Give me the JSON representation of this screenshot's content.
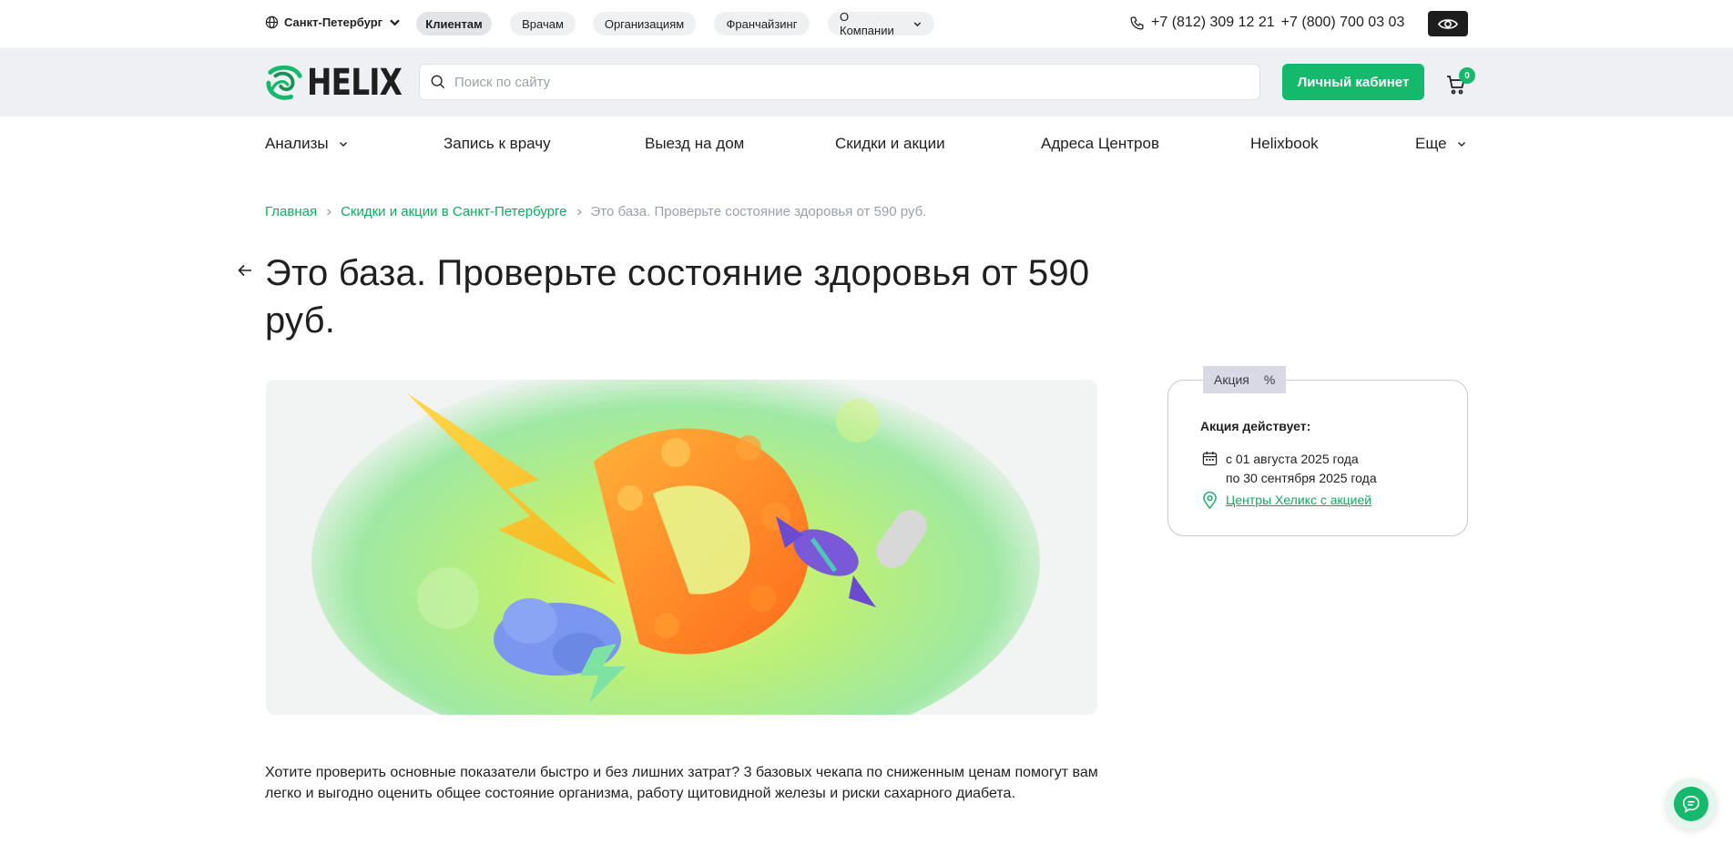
{
  "topbar": {
    "city": "Санкт-Петербург",
    "tabs": [
      {
        "label": "Клиентам",
        "active": true
      },
      {
        "label": "Врачам",
        "active": false
      },
      {
        "label": "Организациям",
        "active": false
      },
      {
        "label": "Франчайзинг",
        "active": false
      },
      {
        "label": "О Компании",
        "active": false
      }
    ],
    "phone1": "+7 (812) 309 12 21",
    "phone2": "+7 (800) 700 03 03"
  },
  "header": {
    "logo_text": "HELIX",
    "search_placeholder": "Поиск по сайту",
    "cabinet_label": "Личный кабинет",
    "cart_count": "0"
  },
  "nav": {
    "items": [
      {
        "label": "Анализы"
      },
      {
        "label": "Запись к врачу"
      },
      {
        "label": "Выезд на дом"
      },
      {
        "label": "Скидки и акции"
      },
      {
        "label": "Адреса Центров"
      },
      {
        "label": "Helixbook"
      },
      {
        "label": "Еще"
      }
    ]
  },
  "breadcrumb": {
    "home": "Главная",
    "section": "Скидки и акции в Санкт-Петербурге",
    "current": "Это база. Проверьте состояние здоровья от 590 руб."
  },
  "page": {
    "title": "Это база. Проверьте состояние здоровья от 590 руб.",
    "description": "Хотите проверить основные показатели быстро и без лишних затрат? 3 базовых чекапа по сниженным ценам помогут вам легко и выгодно оценить общее состояние организма, работу щитовидной железы и риски сахарного диабета."
  },
  "promo": {
    "tag_label": "Акция",
    "tag_symbol": "%",
    "heading": "Акция действует:",
    "date_from": "с 01 августа 2025 года",
    "date_to": "по 30 сентября 2025 года",
    "link": "Центры Хеликс с акцией"
  },
  "colors": {
    "accent": "#14b96b",
    "link": "#14a862",
    "header_bg": "#eef0f4"
  }
}
